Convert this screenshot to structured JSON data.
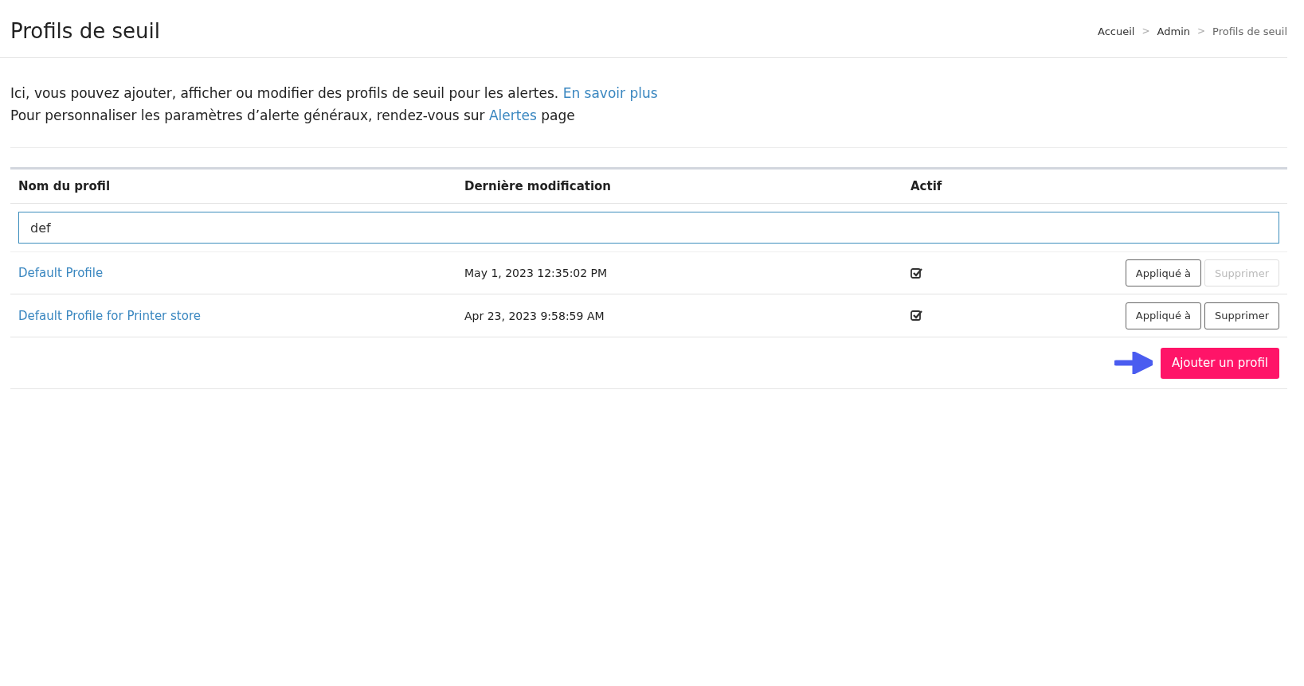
{
  "page_title": "Profils de seuil",
  "breadcrumbs": [
    {
      "label": "Accueil",
      "current": false
    },
    {
      "label": "Admin",
      "current": false
    },
    {
      "label": "Profils de seuil",
      "current": true
    }
  ],
  "separator": ">",
  "intro": [
    {
      "text": "Ici, vous pouvez ajouter, afficher ou modifier des profils de seuil pour les alertes.",
      "link": "En savoir plus"
    },
    {
      "text": "Pour personnaliser les paramètres d’alerte généraux, rendez-vous sur",
      "link": "Alertes",
      "after": "page"
    }
  ],
  "table": {
    "columns": [
      "Nom du profil",
      "Dernière modification",
      "Actif"
    ],
    "filter": {
      "value": "def"
    },
    "rows": [
      {
        "name": "Default Profile",
        "modified": "May 1, 2023 12:35:02 PM",
        "active": true,
        "applied_label": "Appliqué à",
        "delete_label": "Supprimer",
        "delete_disabled": true
      },
      {
        "name": "Default Profile for Printer store",
        "modified": "Apr 23, 2023 9:58:59 AM",
        "active": true,
        "applied_label": "Appliqué à",
        "delete_label": "Supprimer",
        "delete_disabled": false
      }
    ]
  },
  "add_button": "Ajouter un profil"
}
